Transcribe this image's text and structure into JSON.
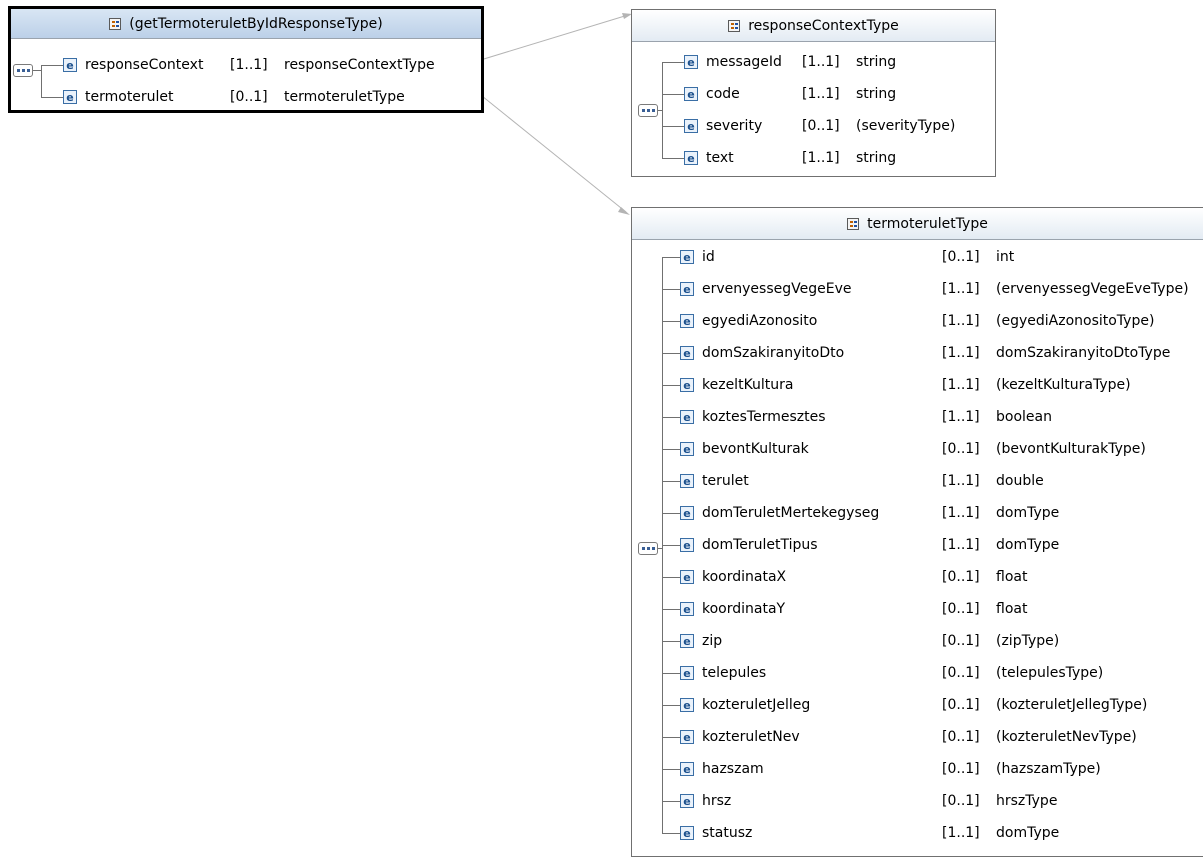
{
  "root": {
    "title": "(getTermoteruletByIdResponseType)",
    "rows": [
      {
        "name": "responseContext",
        "card": "[1..1]",
        "type": "responseContextType"
      },
      {
        "name": "termoterulet",
        "card": "[0..1]",
        "type": "termoteruletType"
      }
    ]
  },
  "responseContextType": {
    "title": "responseContextType",
    "rows": [
      {
        "name": "messageId",
        "card": "[1..1]",
        "type": "string"
      },
      {
        "name": "code",
        "card": "[1..1]",
        "type": "string"
      },
      {
        "name": "severity",
        "card": "[0..1]",
        "type": "(severityType)"
      },
      {
        "name": "text",
        "card": "[1..1]",
        "type": "string"
      }
    ]
  },
  "termoteruletType": {
    "title": "termoteruletType",
    "rows": [
      {
        "name": "id",
        "card": "[0..1]",
        "type": "int"
      },
      {
        "name": "ervenyessegVegeEve",
        "card": "[1..1]",
        "type": "(ervenyessegVegeEveType)"
      },
      {
        "name": "egyediAzonosito",
        "card": "[1..1]",
        "type": "(egyediAzonositoType)"
      },
      {
        "name": "domSzakiranyitoDto",
        "card": "[1..1]",
        "type": "domSzakiranyitoDtoType"
      },
      {
        "name": "kezeltKultura",
        "card": "[1..1]",
        "type": "(kezeltKulturaType)"
      },
      {
        "name": "koztesTermesztes",
        "card": "[1..1]",
        "type": "boolean"
      },
      {
        "name": "bevontKulturak",
        "card": "[0..1]",
        "type": "(bevontKulturakType)"
      },
      {
        "name": "terulet",
        "card": "[1..1]",
        "type": "double"
      },
      {
        "name": "domTeruletMertekegyseg",
        "card": "[1..1]",
        "type": "domType"
      },
      {
        "name": "domTeruletTipus",
        "card": "[1..1]",
        "type": "domType"
      },
      {
        "name": "koordinataX",
        "card": "[0..1]",
        "type": "float"
      },
      {
        "name": "koordinataY",
        "card": "[0..1]",
        "type": "float"
      },
      {
        "name": "zip",
        "card": "[0..1]",
        "type": "(zipType)"
      },
      {
        "name": "telepules",
        "card": "[0..1]",
        "type": "(telepulesType)"
      },
      {
        "name": "kozteruletJelleg",
        "card": "[0..1]",
        "type": "(kozteruletJellegType)"
      },
      {
        "name": "kozteruletNev",
        "card": "[0..1]",
        "type": "(kozteruletNevType)"
      },
      {
        "name": "hazszam",
        "card": "[0..1]",
        "type": "(hazszamType)"
      },
      {
        "name": "hrsz",
        "card": "[0..1]",
        "type": "hrszType"
      },
      {
        "name": "statusz",
        "card": "[1..1]",
        "type": "domType"
      }
    ]
  },
  "icons": {
    "complex_type": "complex-type-icon",
    "element": "element-icon",
    "element_letter": "e",
    "sequence": "sequence-icon"
  },
  "colors": {
    "connector": "#b4b4b4",
    "border": "#707070",
    "selected_border": "#000000",
    "header_selected": "#bcd0e8"
  }
}
